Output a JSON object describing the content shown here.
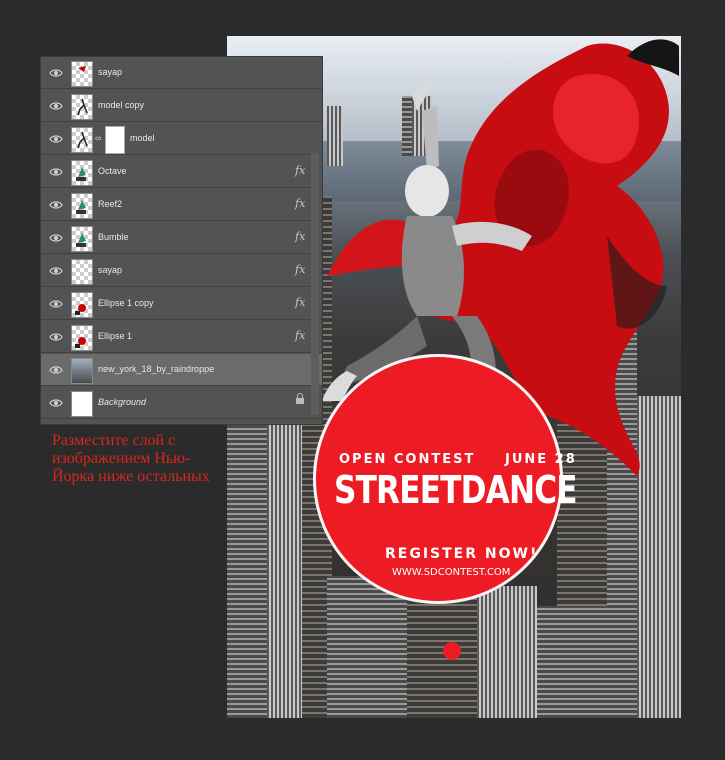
{
  "layers_panel": {
    "layers": [
      {
        "name": "sayap",
        "has_fx": false,
        "has_mask": false,
        "italic": false,
        "selected": false,
        "locked": false,
        "thumb_icon": "red-splash-icon"
      },
      {
        "name": "model copy",
        "has_fx": false,
        "has_mask": false,
        "italic": false,
        "selected": false,
        "locked": false,
        "thumb_icon": "dancer-icon"
      },
      {
        "name": "model",
        "has_fx": false,
        "has_mask": true,
        "italic": false,
        "selected": false,
        "locked": false,
        "thumb_icon": "dancer-icon"
      },
      {
        "name": "Octave",
        "has_fx": true,
        "has_mask": false,
        "italic": false,
        "selected": false,
        "locked": false,
        "thumb_icon": "graphic-icon"
      },
      {
        "name": "Reef2",
        "has_fx": true,
        "has_mask": false,
        "italic": false,
        "selected": false,
        "locked": false,
        "thumb_icon": "graphic-icon"
      },
      {
        "name": "Bumble",
        "has_fx": true,
        "has_mask": false,
        "italic": false,
        "selected": false,
        "locked": false,
        "thumb_icon": "graphic-icon"
      },
      {
        "name": "sayap",
        "has_fx": true,
        "has_mask": false,
        "italic": false,
        "selected": false,
        "locked": false,
        "thumb_icon": "transparent-icon"
      },
      {
        "name": "Ellipse 1 copy",
        "has_fx": true,
        "has_mask": false,
        "italic": false,
        "selected": false,
        "locked": false,
        "thumb_icon": "shape-icon"
      },
      {
        "name": "Ellipse 1",
        "has_fx": true,
        "has_mask": false,
        "italic": false,
        "selected": false,
        "locked": false,
        "thumb_icon": "shape-icon"
      },
      {
        "name": "new_york_18_by_raindroppe",
        "has_fx": false,
        "has_mask": false,
        "italic": false,
        "selected": true,
        "locked": false,
        "thumb_icon": "city-photo-icon"
      },
      {
        "name": "Background",
        "has_fx": false,
        "has_mask": false,
        "italic": true,
        "selected": false,
        "locked": true,
        "thumb_icon": "white-fill-icon"
      }
    ],
    "fx_label": "fx"
  },
  "caption": "Разместите слой с изображением Нью-Йорка ниже остальных",
  "poster": {
    "open_contest": "OPEN CONTEST",
    "date": "JUNE 28",
    "headline": "STREETDANCE",
    "register": "REGISTER NOW!",
    "website": "WWW.SDCONTEST.COM",
    "accent_color": "#ed1c24"
  }
}
